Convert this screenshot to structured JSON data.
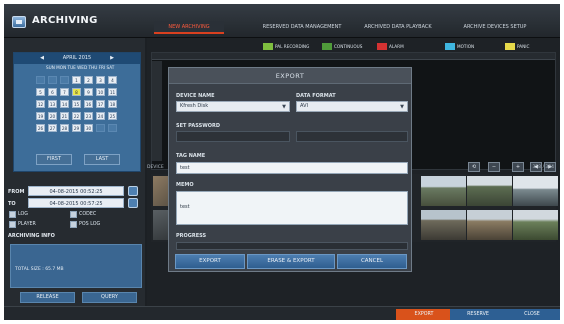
{
  "app": {
    "title": "ARCHIVING"
  },
  "tabs": [
    {
      "label": "NEW ARCHIVING",
      "active": true
    },
    {
      "label": "RESERVED DATA MANAGEMENT",
      "active": false
    },
    {
      "label": "ARCHIVED DATA PLAYBACK",
      "active": false
    },
    {
      "label": "ARCHIVE DEVICES SETUP",
      "active": false
    }
  ],
  "calendar": {
    "month": "APRIL 2015",
    "prev": "◀",
    "next": "▶",
    "weekdays": "SUN MON TUE WED THU FRI SAT",
    "days": [
      [
        "",
        "",
        "",
        "1",
        "2",
        "3",
        "4"
      ],
      [
        "5",
        "6",
        "7",
        "8",
        "9",
        "10",
        "11"
      ],
      [
        "12",
        "13",
        "14",
        "15",
        "16",
        "17",
        "18"
      ],
      [
        "19",
        "20",
        "21",
        "22",
        "23",
        "24",
        "25"
      ],
      [
        "26",
        "27",
        "28",
        "29",
        "30",
        "",
        ""
      ]
    ],
    "highlight": "8",
    "first_button": "FIRST",
    "last_button": "LAST"
  },
  "range": {
    "from_label": "FROM",
    "from_value": "04-08-2015 00:52:25",
    "to_label": "TO",
    "to_value": "04-08-2015 00:57:25"
  },
  "options": [
    {
      "label": "LOG",
      "checked": false
    },
    {
      "label": "CODEC",
      "checked": false
    },
    {
      "label": "PLAYER",
      "checked": false
    },
    {
      "label": "POS LOG",
      "checked": false
    }
  ],
  "archiving_info": {
    "title": "ARCHIVING INFO",
    "total_size": "TOTAL SIZE : 65.7 MB"
  },
  "left_buttons": {
    "release": "RELEASE",
    "query": "QUERY"
  },
  "legend": [
    {
      "label": "PAL RECORDING",
      "color": "#7fbf3f"
    },
    {
      "label": "CONTINUOUS",
      "color": "#4f9b3a"
    },
    {
      "label": "ALARM",
      "color": "#d43232"
    },
    {
      "label": "MOTION",
      "color": "#3fb6e0"
    },
    {
      "label": "PANIC",
      "color": "#e6d94a"
    }
  ],
  "thumbnails": {
    "label": "DEVICE",
    "count": "358 / 384"
  },
  "modal": {
    "title": "EXPORT",
    "device_name_label": "DEVICE NAME",
    "device_name_value": "Kfresh Disk",
    "data_format_label": "DATA FORMAT",
    "data_format_value": "AVI",
    "set_password_label": "SET PASSWORD",
    "tag_name_label": "TAG NAME",
    "tag_name_value": "test",
    "memo_label": "MEMO",
    "memo_value": "test",
    "progress_label": "PROGRESS",
    "progress_value": 0,
    "export_button": "EXPORT",
    "erase_export_button": "ERASE & EXPORT",
    "cancel_button": "CANCEL"
  },
  "bottom_buttons": [
    {
      "label": "EXPORT",
      "color": "#d9521b"
    },
    {
      "label": "RESERVE",
      "color": "#2d5f93"
    },
    {
      "label": "CLOSE",
      "color": "#2d5f93"
    }
  ]
}
